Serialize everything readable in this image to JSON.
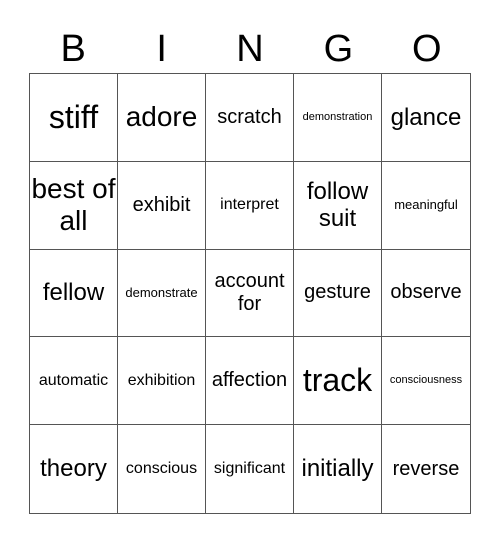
{
  "header": {
    "letters": [
      "B",
      "I",
      "N",
      "G",
      "O"
    ]
  },
  "cells": [
    "stiff",
    "adore",
    "scratch",
    "demonstration",
    "glance",
    "best of all",
    "exhibit",
    "interpret",
    "follow suit",
    "meaningful",
    "fellow",
    "demonstrate",
    "account for",
    "gesture",
    "observe",
    "automatic",
    "exhibition",
    "affection",
    "track",
    "consciousness",
    "theory",
    "conscious",
    "significant",
    "initially",
    "reverse"
  ]
}
